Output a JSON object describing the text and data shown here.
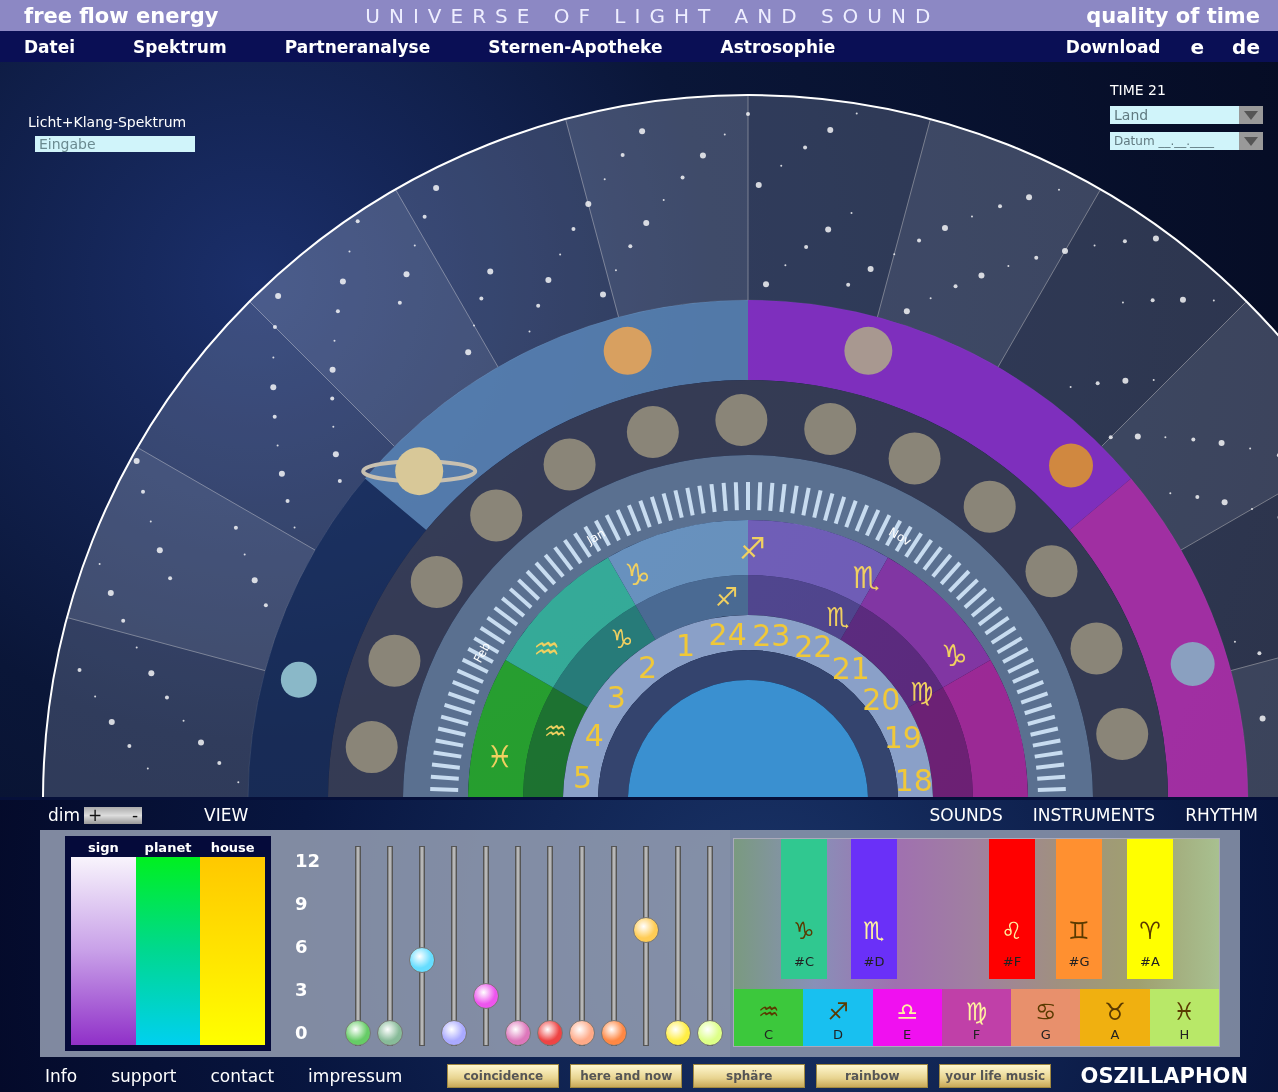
{
  "header": {
    "left": "free flow energy",
    "title": "UNIVERSE OF LIGHT AND SOUND",
    "right": "quality of time"
  },
  "menu": [
    {
      "label": "Datei"
    },
    {
      "label": "Spektrum"
    },
    {
      "label": "Partneranalyse"
    },
    {
      "label": "Sternen-Apotheke"
    },
    {
      "label": "Astrosophie"
    }
  ],
  "menu_right": [
    {
      "label": "Download"
    },
    {
      "label": "e"
    },
    {
      "label": "de"
    }
  ],
  "spectrum": {
    "label": "Licht+Klang-Spektrum",
    "placeholder": "Eingabe"
  },
  "time": {
    "label": "TIME 21",
    "fields": [
      {
        "placeholder": "Land"
      },
      {
        "placeholder": "Datum __.__.____"
      }
    ]
  },
  "wheel": {
    "months": [
      "Feb",
      "Jan",
      "Nov"
    ],
    "signs": [
      "♓",
      "♒",
      "♑",
      "♐",
      "♏",
      "♑"
    ],
    "inner_signs": [
      "♒",
      "♑",
      "♐",
      "♏",
      "♍"
    ],
    "houses": [
      "5",
      "4",
      "3",
      "2",
      "1",
      "24",
      "23",
      "22",
      "21",
      "20",
      "19",
      "18"
    ]
  },
  "view": {
    "dim": "dim",
    "plus": "+",
    "minus": "-",
    "label": "VIEW"
  },
  "legend": [
    {
      "label": "sign"
    },
    {
      "label": "planet"
    },
    {
      "label": "house"
    }
  ],
  "scale": [
    "12",
    "9",
    "6",
    "3",
    "0"
  ],
  "sliders": [
    {
      "color": "#66cc66",
      "level": 0
    },
    {
      "color": "#88bb99",
      "level": 0
    },
    {
      "color": "#66ddff",
      "level": 0.42
    },
    {
      "color": "#aaaaff",
      "level": 0
    },
    {
      "color": "#ee55ee",
      "level": 0.21
    },
    {
      "color": "#dd77bb",
      "level": 0
    },
    {
      "color": "#ee4444",
      "level": 0
    },
    {
      "color": "#ffaa88",
      "level": 0
    },
    {
      "color": "#ff8844",
      "level": 0
    },
    {
      "color": "#ffcc55",
      "level": 0.59
    },
    {
      "color": "#ffee44",
      "level": 0
    },
    {
      "color": "#ddff88",
      "level": 0
    }
  ],
  "tabs": [
    "SOUNDS",
    "INSTRUMENTS",
    "RHYTHM"
  ],
  "white_keys": [
    {
      "note": "C",
      "sign": "♒",
      "color": "#3cc83c"
    },
    {
      "note": "D",
      "sign": "♐",
      "color": "#18c0f0"
    },
    {
      "note": "E",
      "sign": "♎",
      "color": "#f010f0"
    },
    {
      "note": "F",
      "sign": "♍",
      "color": "#c040a8"
    },
    {
      "note": "G",
      "sign": "♋",
      "color": "#e8906c"
    },
    {
      "note": "A",
      "sign": "♉",
      "color": "#f0b010"
    },
    {
      "note": "H",
      "sign": "♓",
      "color": "#b8e868"
    }
  ],
  "black_keys": [
    {
      "note": "#C",
      "sign": "♑",
      "color": "#30c890"
    },
    {
      "note": "#D",
      "sign": "♏",
      "color": "#6a30f8"
    },
    {
      "note": "#F",
      "sign": "♌",
      "color": "#ff0000"
    },
    {
      "note": "#G",
      "sign": "♊",
      "color": "#ff9030"
    },
    {
      "note": "#A",
      "sign": "♈",
      "color": "#ffff00"
    }
  ],
  "footer": {
    "links": [
      "Info",
      "support",
      "contact",
      "impressum"
    ],
    "buttons": [
      "coincidence",
      "here and now",
      "sphäre",
      "rainbow",
      "your life music"
    ],
    "brand": "OSZILLAPHON"
  }
}
